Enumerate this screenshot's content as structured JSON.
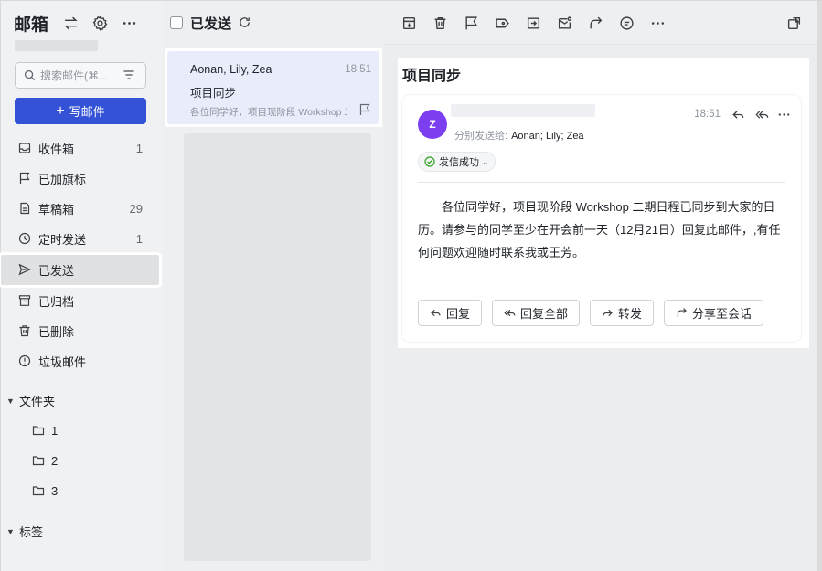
{
  "sidebar": {
    "title": "邮箱",
    "search_placeholder": "搜索邮件(⌘...",
    "compose_label": "写邮件",
    "items": [
      {
        "label": "收件箱",
        "count": "1",
        "icon": "inbox-icon"
      },
      {
        "label": "已加旗标",
        "count": "",
        "icon": "flag-icon"
      },
      {
        "label": "草稿箱",
        "count": "29",
        "icon": "draft-icon"
      },
      {
        "label": "定时发送",
        "count": "1",
        "icon": "clock-icon"
      },
      {
        "label": "已发送",
        "count": "",
        "icon": "send-icon",
        "active": true
      },
      {
        "label": "已归档",
        "count": "",
        "icon": "archive-icon"
      },
      {
        "label": "已删除",
        "count": "",
        "icon": "trash-icon"
      },
      {
        "label": "垃圾邮件",
        "count": "",
        "icon": "spam-icon"
      }
    ],
    "folders_section": "文件夹",
    "folders": [
      "1",
      "2",
      "3"
    ],
    "tags_section": "标签"
  },
  "list": {
    "title": "已发送",
    "messages": [
      {
        "from": "Aonan, Lily, Zea",
        "time": "18:51",
        "subject": "项目同步",
        "preview": "各位同学好，项目现阶段 Workshop 二期日程已同步到大家的日历"
      }
    ]
  },
  "reader": {
    "subject": "项目同步",
    "avatar_letter": "Z",
    "recipients_label": "分别发送给:",
    "recipients": "Aonan;   Lily;   Zea",
    "time": "18:51",
    "status": "发信成功",
    "body": "各位同学好，项目现阶段 Workshop 二期日程已同步到大家的日历。请参与的同学至少在开会前一天（12月21日）回复此邮件，,有任何问题欢迎随时联系我或王芳。",
    "actions": [
      "回复",
      "回复全部",
      "转发",
      "分享至会话"
    ]
  },
  "colors": {
    "accent": "#3352d6",
    "avatar": "#7b3ef0",
    "selected_item": "#e9ecfb",
    "success": "#2ea121"
  }
}
